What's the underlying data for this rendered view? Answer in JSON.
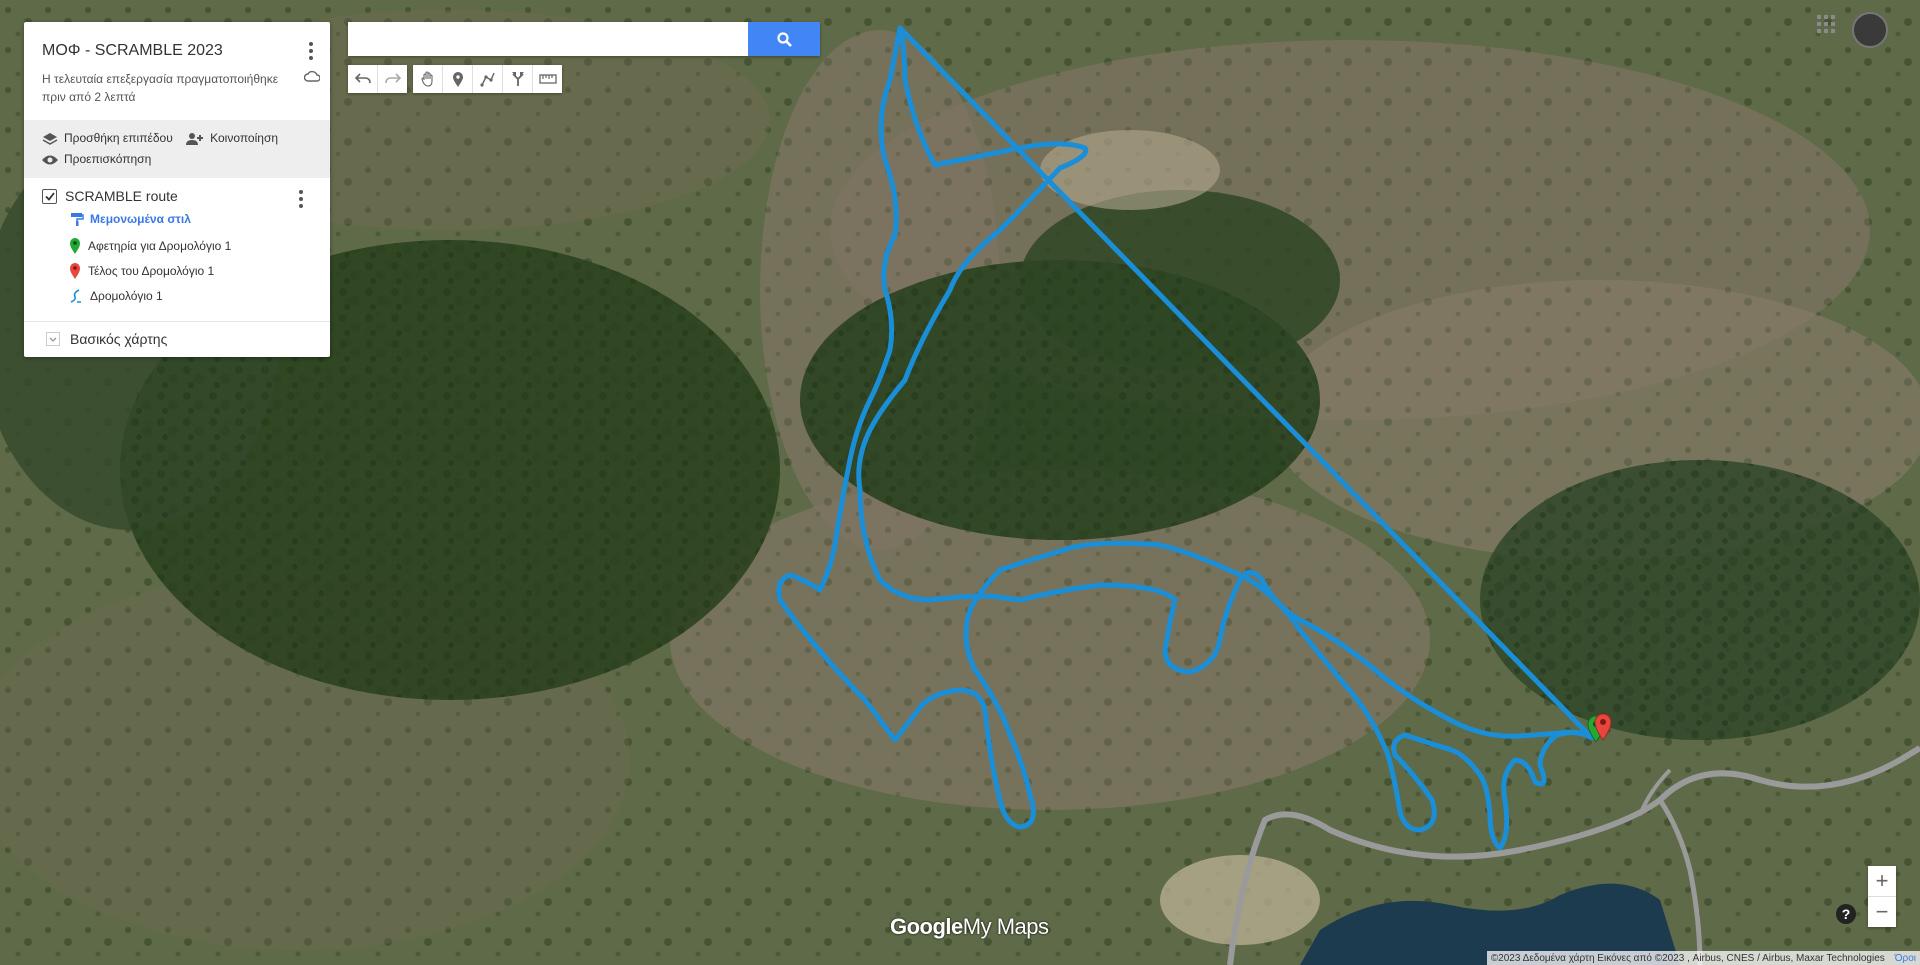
{
  "map": {
    "route_color": "#1a8fd8",
    "start_marker_color": "#22a833",
    "end_marker_color": "#e8453c",
    "road_color": "#9a9a9a",
    "water_color": "#1d3b4f"
  },
  "panel": {
    "title": "ΜΟΦ - SCRAMBLE 2023",
    "last_edit": "Η τελευταία επεξεργασία πραγματοποιήθηκε πριν από 2 λεπτά",
    "actions": {
      "add_layer": "Προσθήκη επιπέδου",
      "share": "Κοινοποίηση",
      "preview": "Προεπισκόπηση"
    },
    "layer": {
      "name": "SCRAMBLE route",
      "checked": true,
      "style_link": "Μεμονωμένα στιλ",
      "features": [
        {
          "label": "Αφετηρία για Δρομολόγιο 1",
          "icon": "green-pin-icon"
        },
        {
          "label": "Τέλος του Δρομολόγιο 1",
          "icon": "red-pin-icon"
        },
        {
          "label": "Δρομολόγιο 1",
          "icon": "route-icon"
        }
      ]
    },
    "base_map": "Βασικός χάρτης"
  },
  "search": {
    "placeholder": "",
    "value": ""
  },
  "logo": {
    "google": "Google",
    "product": "My Maps"
  },
  "attribution": {
    "text": "©2023 Δεδομένα χάρτη Εικόνες από ©2023 , Airbus, CNES / Airbus, Maxar Technologies",
    "terms": "Όροι"
  },
  "zoom": {
    "in": "+",
    "out": "−"
  },
  "help": "?"
}
